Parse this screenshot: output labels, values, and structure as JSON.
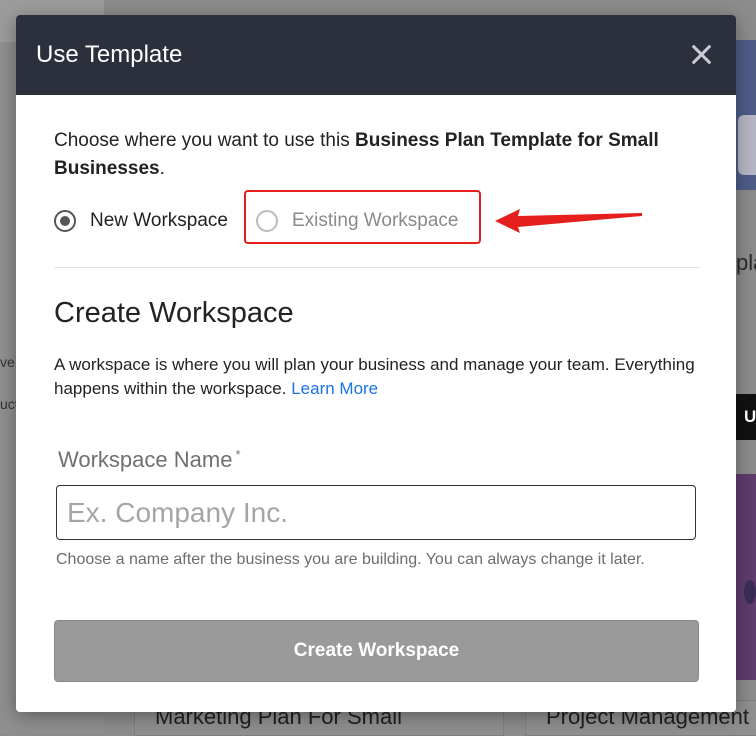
{
  "background": {
    "side_text_1": "ve",
    "side_text_2": "uct",
    "right_card_title": "pla",
    "right_button_label": "U",
    "bottom_card_left": "Marketing Plan For Small",
    "bottom_card_right": "Project Management"
  },
  "modal": {
    "title": "Use Template",
    "close_label": "×",
    "intro_prefix": "Choose where you want to use this ",
    "intro_template_name": "Business Plan Template for Small Businesses",
    "intro_suffix": ".",
    "options": [
      {
        "label": "New Workspace",
        "selected": true
      },
      {
        "label": "Existing Workspace",
        "selected": false
      }
    ],
    "section_title": "Create Workspace",
    "description": "A workspace is where you will plan your business and manage your team. Everything happens within the workspace. ",
    "learn_more": "Learn More",
    "field_label": "Workspace Name",
    "required_mark": "*",
    "field_placeholder": "Ex. Company Inc.",
    "field_value": "",
    "hint": "Choose a name after the business you are building. You can always change it later.",
    "submit_label": "Create Workspace"
  },
  "colors": {
    "header_bg": "#2c303c",
    "highlight": "#e51e1e",
    "link": "#1a73e8",
    "button_disabled": "#9a9a9a"
  },
  "icons": {
    "close": "close-icon",
    "annotation": "red-arrow-icon"
  }
}
